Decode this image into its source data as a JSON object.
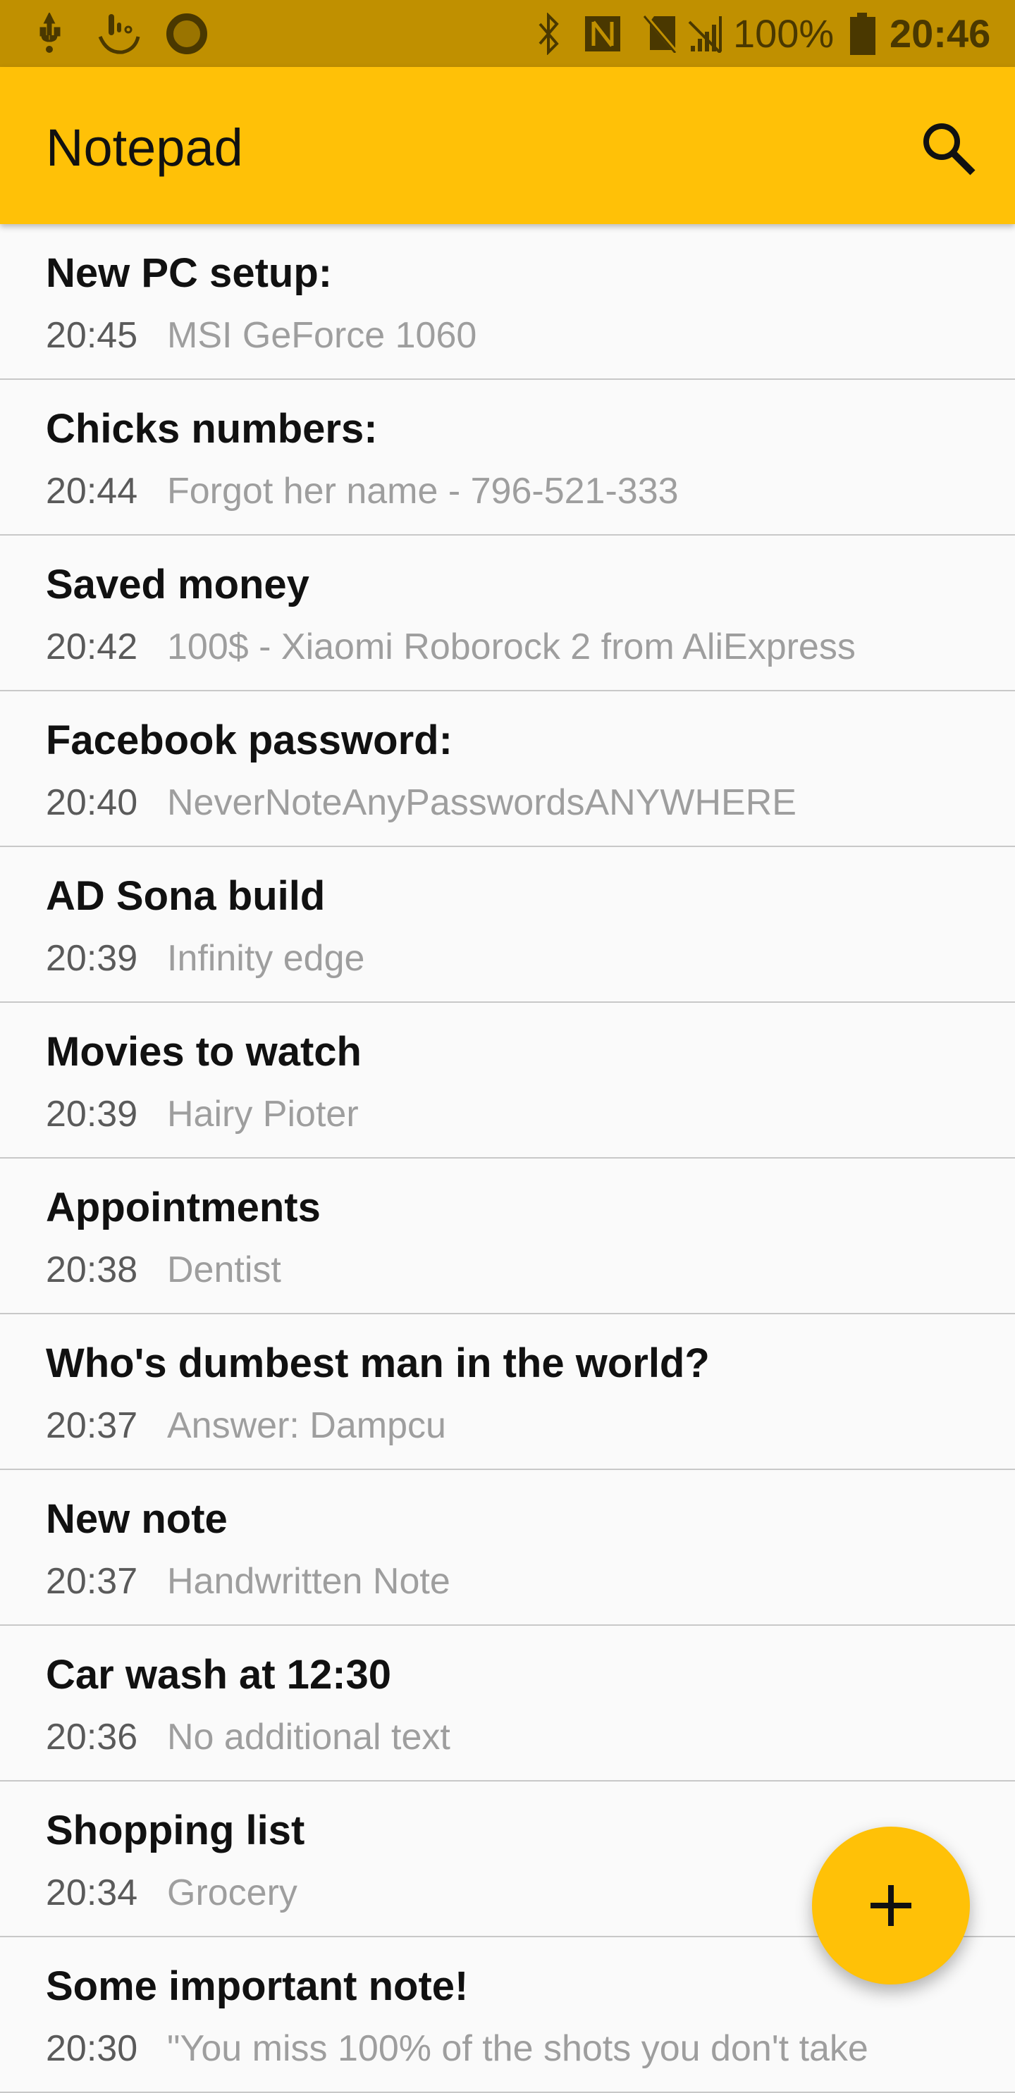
{
  "status_bar": {
    "battery": "100%",
    "time": "20:46",
    "icons": [
      "usb-icon",
      "touch-icon",
      "record-icon",
      "bluetooth-icon",
      "nfc-icon",
      "no-sim-icon",
      "no-signal-icon",
      "battery-icon"
    ]
  },
  "app_bar": {
    "title": "Notepad",
    "search_icon": "search-icon"
  },
  "notes": [
    {
      "title": "New PC setup:",
      "time": "20:45",
      "preview": "MSI GeForce 1060"
    },
    {
      "title": "Chicks numbers:",
      "time": "20:44",
      "preview": "Forgot her name - 796-521-333"
    },
    {
      "title": "Saved money",
      "time": "20:42",
      "preview": "100$ - Xiaomi Roborock 2 from AliExpress"
    },
    {
      "title": "Facebook password:",
      "time": "20:40",
      "preview": "NeverNoteAnyPasswordsANYWHERE"
    },
    {
      "title": "AD Sona build",
      "time": "20:39",
      "preview": "Infinity edge"
    },
    {
      "title": "Movies to watch",
      "time": "20:39",
      "preview": "Hairy Pioter"
    },
    {
      "title": "Appointments",
      "time": "20:38",
      "preview": "Dentist"
    },
    {
      "title": "Who's dumbest man in the world?",
      "time": "20:37",
      "preview": "Answer: Dampcu"
    },
    {
      "title": "New note",
      "time": "20:37",
      "preview": "Handwritten Note"
    },
    {
      "title": "Car wash at 12:30",
      "time": "20:36",
      "preview": "No additional text"
    },
    {
      "title": "Shopping list",
      "time": "20:34",
      "preview": "Grocery"
    },
    {
      "title": "Some important note!",
      "time": "20:30",
      "preview": "\"You miss 100% of the shots you don't take"
    }
  ],
  "fab": {
    "icon": "plus-icon",
    "color": "#ffc107"
  }
}
